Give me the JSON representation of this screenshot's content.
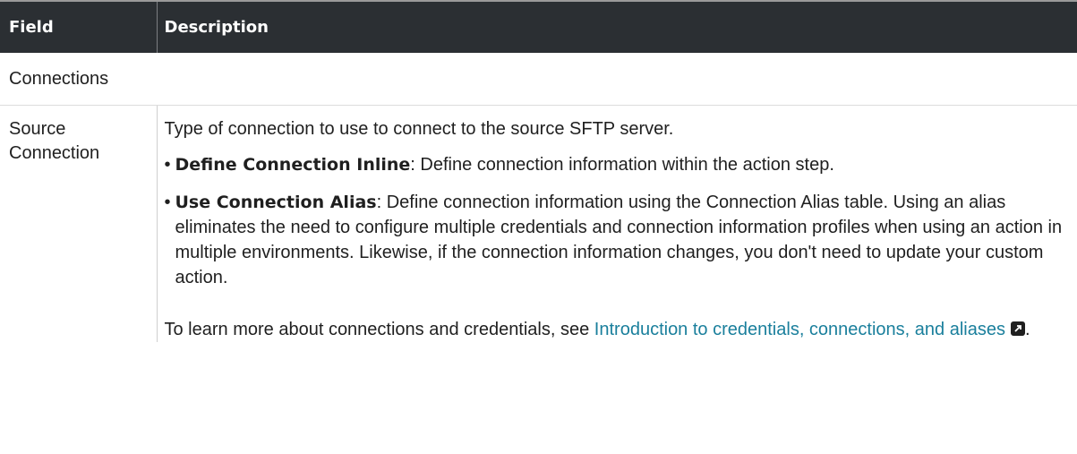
{
  "header": {
    "field_label": "Field",
    "description_label": "Description"
  },
  "section": {
    "label": "Connections"
  },
  "row": {
    "field_line1": "Source",
    "field_line2": "Connection",
    "intro": "Type of connection to use to connect to the source SFTP server.",
    "bullets": [
      {
        "term": "Define Connection Inline",
        "text": ": Define connection information within the action step."
      },
      {
        "term": "Use Connection Alias",
        "text": ": Define connection information using the Connection Alias table. Using an alias eliminates the need to configure multiple credentials and connection information profiles when using an action in multiple environments. Likewise, if the connection information changes, you don't need to update your custom action."
      }
    ],
    "more_prefix": "To learn more about connections and credentials, see ",
    "more_link": "Introduction to credentials, connections, and aliases",
    "more_suffix": ".",
    "link_icon": "external-link-icon"
  },
  "colors": {
    "header_bg": "#2b2f33",
    "link": "#1a7f9c"
  }
}
